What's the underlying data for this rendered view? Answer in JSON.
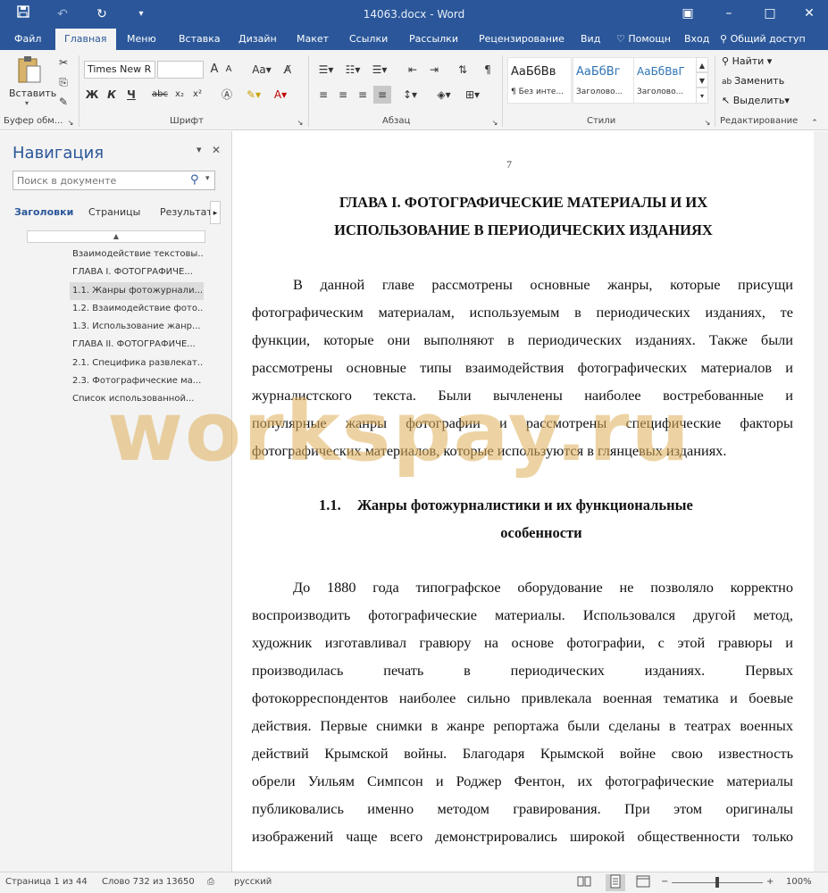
{
  "titlebar": {
    "doc_title": "14063.docx - Word",
    "save_icon": "save-icon",
    "undo_icon": "undo-icon",
    "redo_icon": "redo-icon",
    "customize_icon": "customize-qat-icon"
  },
  "ribbon_tabs": {
    "file": "Файл",
    "home": "Главная",
    "menu": "Меню",
    "insert": "Вставка",
    "design": "Дизайн",
    "layout": "Макет",
    "references": "Ссылки",
    "mailings": "Рассылки",
    "review": "Рецензирование",
    "view": "Вид",
    "tell_me": "Помощн",
    "sign_in": "Вход",
    "share": "Общий доступ"
  },
  "ribbon": {
    "paste_label": "Вставить",
    "clipboard_group": "Буфер обм...",
    "font_name": "Times New R",
    "font_size": "",
    "font_group": "Шрифт",
    "bold": "Ж",
    "italic": "К",
    "underline": "Ч",
    "strike": "abc",
    "subscript": "x₂",
    "superscript": "x²",
    "grow": "A",
    "shrink": "A",
    "case": "Aa",
    "paragraph_group": "Абзац",
    "styles": [
      {
        "sample": "АаБбВв",
        "name": "¶ Без инте..."
      },
      {
        "sample": "АаБбВг",
        "name": "Заголово..."
      },
      {
        "sample": "АаБбВвГ",
        "name": "Заголово..."
      }
    ],
    "styles_group": "Стили",
    "find": "Найти",
    "replace": "Заменить",
    "select": "Выделить",
    "editing_group": "Редактирование"
  },
  "nav": {
    "title": "Навигация",
    "search_placeholder": "Поиск в документе",
    "tabs": [
      "Заголовки",
      "Страницы",
      "Результаты"
    ],
    "headings": [
      {
        "text": "Взаимодействие текстовы...",
        "selected": false
      },
      {
        "text": "ГЛАВА I. ФОТОГРАФИЧЕ...",
        "selected": false
      },
      {
        "text": "1.1. Жанры фотожурнали...",
        "selected": true
      },
      {
        "text": "1.2. Взаимодействие фото...",
        "selected": false
      },
      {
        "text": "1.3. Использование жанр...",
        "selected": false
      },
      {
        "text": "ГЛАВА II. ФОТОГРАФИЧЕ...",
        "selected": false
      },
      {
        "text": "2.1. Специфика развлекат...",
        "selected": false
      },
      {
        "text": "2.3. Фотографические ма...",
        "selected": false
      },
      {
        "text": "Список использованной...",
        "selected": false
      }
    ]
  },
  "document": {
    "page_number": "7",
    "chapter_title_1": "ГЛАВА I. ФОТОГРАФИЧЕСКИЕ МАТЕРИАЛЫ И ИХ",
    "chapter_title_2": "ИСПОЛЬЗОВАНИЕ В ПЕРИОДИЧЕСКИХ ИЗДАНИЯХ",
    "para1": [
      "В данной главе рассмотрены основные жанры, которые присущи",
      "фотографическим материалам, используемым в периодических изданиях, те",
      "функции, которые они выполняют в периодических изданиях. Также были",
      "рассмотрены основные типы взаимодействия фотографических материалов и",
      "журналистского текста. Были вычленены наиболее востребованные и",
      "популярные жанры фотографии и рассмотрены специфические факторы",
      "фотографических материалов, которые используются в глянцевых изданиях."
    ],
    "section_number": "1.1.",
    "section_title_1": "Жанры фотожурналистики и их функциональные",
    "section_title_2": "особенности",
    "para2": [
      "До 1880 года типографское оборудование не позволяло корректно",
      "воспроизводить фотографические материалы. Использовался другой метод,",
      "художник изготавливал гравюру на основе фотографии, с этой гравюры и",
      "производилась печать в периодических изданиях. Первых",
      "фотокорреспондентов наиболее сильно привлекала военная тематика и боевые",
      "действия. Первые снимки в жанре репортажа были сделаны в театрах военных",
      "действий Крымской войны. Благодаря Крымской войне свою известность",
      "обрели Уильям Симпсон и Роджер Фентон, их фотографические материалы",
      "публиковались именно методом гравирования. При этом оригиналы",
      "изображений чаще всего демонстрировались широкой общественности только"
    ],
    "watermark": "workspay.ru"
  },
  "status": {
    "page": "Страница 1 из 44",
    "words": "Слово 732 из 13650",
    "language": "русский",
    "zoom": "100%",
    "zoom_fraction": 0.5
  }
}
